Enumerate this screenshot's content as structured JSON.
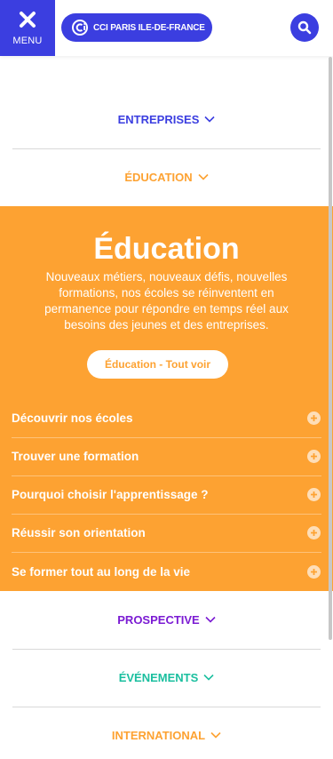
{
  "header": {
    "menu_label": "MENU",
    "brand_label": "CCI PARIS ILE-DE-FRANCE"
  },
  "colors": {
    "brand_blue": "#3b3ee0",
    "education_orange": "#fda232",
    "prospective_purple": "#7b1bd3",
    "evenements_teal": "#1bbf9f",
    "international_orange": "#fda232"
  },
  "nav": {
    "entreprises": "ENTREPRISES",
    "education": "ÉDUCATION",
    "prospective": "PROSPECTIVE",
    "evenements": "ÉVÉNEMENTS",
    "international": "INTERNATIONAL"
  },
  "education_panel": {
    "title": "Éducation",
    "description": "Nouveaux métiers, nouveaux défis, nouvelles formations, nos écoles se réinventent en permanence pour répondre en temps réel aux besoins des jeunes et des entreprises.",
    "see_all_label": "Éducation - Tout voir",
    "items": [
      {
        "label": "Découvrir nos écoles"
      },
      {
        "label": "Trouver une formation"
      },
      {
        "label": "Pourquoi choisir l'apprentissage ?"
      },
      {
        "label": "Réussir son orientation"
      },
      {
        "label": "Se former tout au long de la vie"
      }
    ]
  },
  "icons": {
    "menu": "close-icon",
    "brand": "cci-logo-icon",
    "search": "search-icon",
    "chevron": "chevron-down-icon",
    "expand": "plus-circle-icon"
  }
}
